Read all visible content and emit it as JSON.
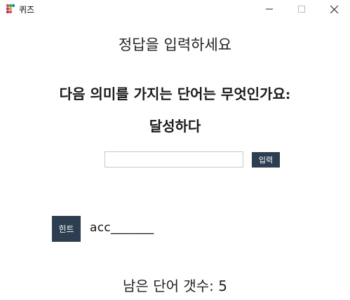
{
  "window": {
    "title": "퀴즈",
    "app_icon": "quiz-app-icon",
    "controls": [
      "minimize-icon",
      "maximize-icon",
      "close-icon"
    ]
  },
  "main": {
    "prompt": "정답을 입력하세요",
    "question": "다음 의미를 가지는 단어는 무엇인가요:",
    "meaning": "달성하다",
    "answer_input": {
      "value": "",
      "placeholder": ""
    },
    "submit_label": "입력",
    "hint_label": "힌트",
    "hint_text": "acc_______",
    "remaining": "남은 단어 갯수: 5"
  },
  "colors": {
    "button_bg": "#2c3e50",
    "button_text": "#ffffff",
    "background": "#ffffff"
  }
}
